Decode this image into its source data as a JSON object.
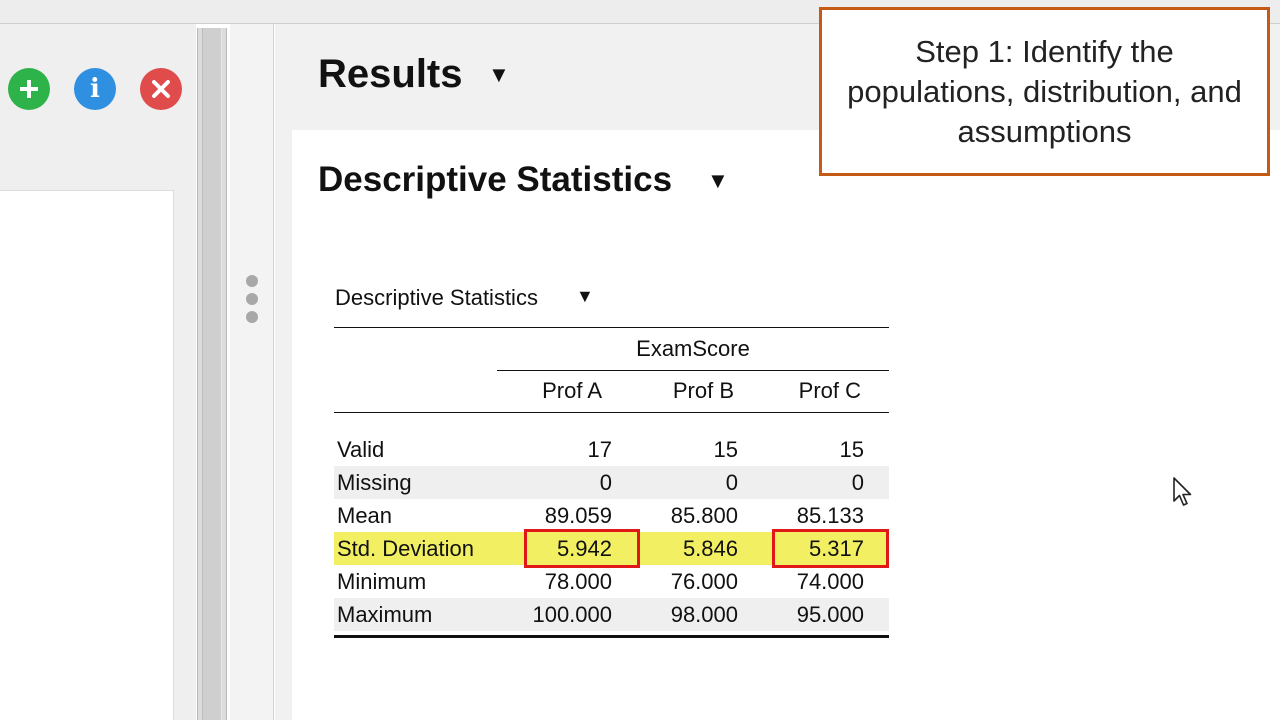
{
  "toolbar": {
    "add_icon": "plus-icon",
    "info_icon": "info-icon",
    "close_icon": "close-icon",
    "add_glyph": "+",
    "info_glyph": "i",
    "close_glyph": "✕"
  },
  "results": {
    "title": "Results",
    "caret": "▼"
  },
  "section": {
    "title": "Descriptive Statistics",
    "caret": "▼"
  },
  "table": {
    "title": "Descriptive Statistics",
    "caret": "▼",
    "group_header": "ExamScore",
    "columns": [
      "Prof A",
      "Prof B",
      "Prof C"
    ],
    "rows": [
      {
        "label": "Valid",
        "values": [
          "17",
          "15",
          "15"
        ]
      },
      {
        "label": "Missing",
        "values": [
          "0",
          "0",
          "0"
        ]
      },
      {
        "label": "Mean",
        "values": [
          "89.059",
          "85.800",
          "85.133"
        ]
      },
      {
        "label": "Std. Deviation",
        "values": [
          "5.942",
          "5.846",
          "5.317"
        ]
      },
      {
        "label": "Minimum",
        "values": [
          "78.000",
          "76.000",
          "74.000"
        ]
      },
      {
        "label": "Maximum",
        "values": [
          "100.000",
          "98.000",
          "95.000"
        ]
      }
    ],
    "highlight_color": "#f2f062",
    "box_color": "#e01818"
  },
  "callout": {
    "text": "Step 1: Identify the populations, distribution, and assumptions",
    "border_color": "#c45a14"
  }
}
